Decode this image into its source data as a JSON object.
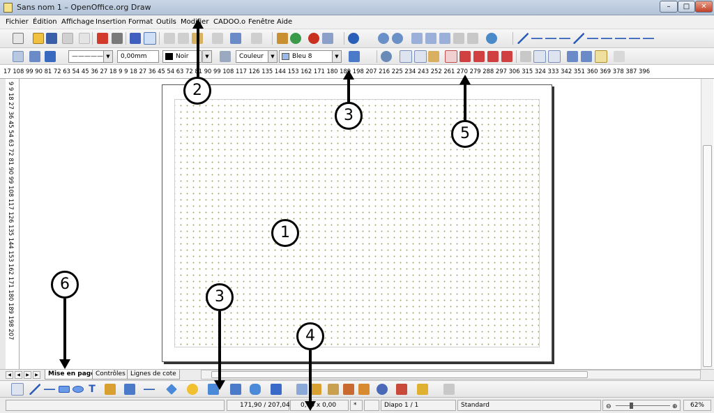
{
  "window": {
    "title": "Sans nom 1 – OpenOffice.org Draw"
  },
  "menu": [
    "Fichier",
    "Édition",
    "Affichage",
    "Insertion",
    "Format",
    "Outils",
    "Modifier",
    "CADOO.o",
    "Fenêtre",
    "Aide"
  ],
  "line_props": {
    "width": "0,00mm",
    "color": "Noir",
    "area_style": "Couleur",
    "area_color": "Bleu 8"
  },
  "ruler": {
    "horizontal": "17 108 99 90 81 72 63 54 45 36 27 18 9         9  18  27  36  45  54  63  72  81  90  99  108 117 126 135 144 153 162 171 180 189 198 207 216 225 234 243 252 261 270 279 288 297 306 315 324 333 342 351 360 369 378 387 396",
    "vertical": "9      9   18  27  36  45  54  63  72  81  90  99 108 117 126 135 144 153 162 171 180 189 198 207"
  },
  "tabs": [
    "Mise en page",
    "Contrôles",
    "Lignes de cote"
  ],
  "status": {
    "position": "171,90 / 207,04",
    "size": "0,00 x 0,00",
    "modified": "*",
    "slide": "Diapo 1 / 1",
    "layout": "Standard",
    "zoom": "62%"
  },
  "callouts": [
    "1",
    "2",
    "3",
    "3",
    "4",
    "5",
    "6"
  ],
  "colors": {
    "titlebar": "#b9c9dd",
    "close": "#c2402a"
  }
}
